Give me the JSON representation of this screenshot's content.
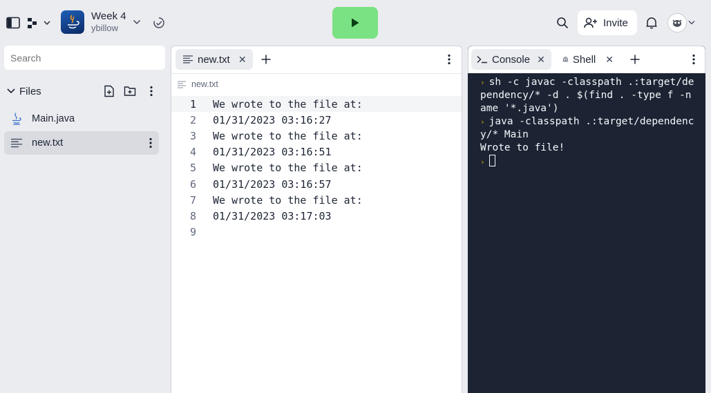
{
  "header": {
    "repl_title": "Week 4",
    "repl_owner": "ybillow",
    "invite_label": "Invite",
    "icons": {
      "sidebar": "sidebar-toggle-icon",
      "branch": "branch-icon",
      "run": "play-icon",
      "search": "search-icon",
      "bell": "bell-icon"
    },
    "run_button_color": "#7be283"
  },
  "sidebar": {
    "search_placeholder": "Search",
    "files_label": "Files",
    "files": [
      {
        "name": "Main.java",
        "icon": "java-icon",
        "active": false
      },
      {
        "name": "new.txt",
        "icon": "text-file-icon",
        "active": true
      }
    ]
  },
  "editor": {
    "tab_label": "new.txt",
    "breadcrumb": "new.txt",
    "current_line": 1,
    "lines": [
      {
        "n": "1",
        "text": "We wrote to the file at:"
      },
      {
        "n": "2",
        "text": "01/31/2023 03:16:27"
      },
      {
        "n": "3",
        "text": "We wrote to the file at:"
      },
      {
        "n": "4",
        "text": "01/31/2023 03:16:51"
      },
      {
        "n": "5",
        "text": "We wrote to the file at:"
      },
      {
        "n": "6",
        "text": "01/31/2023 03:16:57"
      },
      {
        "n": "7",
        "text": "We wrote to the file at:"
      },
      {
        "n": "8",
        "text": "01/31/2023 03:17:03"
      },
      {
        "n": "9",
        "text": ""
      }
    ]
  },
  "console": {
    "tabs": [
      {
        "label": "Console",
        "active": true
      },
      {
        "label": "Shell",
        "active": false
      }
    ],
    "output": [
      {
        "prompt": true,
        "text": "sh -c javac -classpath .:target/dependency/* -d . $(find . -type f -name '*.java')"
      },
      {
        "prompt": true,
        "text": "java -classpath .:target/dependency/* Main"
      },
      {
        "prompt": false,
        "text": "Wrote to file!"
      }
    ],
    "background": "#1c2333",
    "prompt_color": "#c9a900"
  }
}
